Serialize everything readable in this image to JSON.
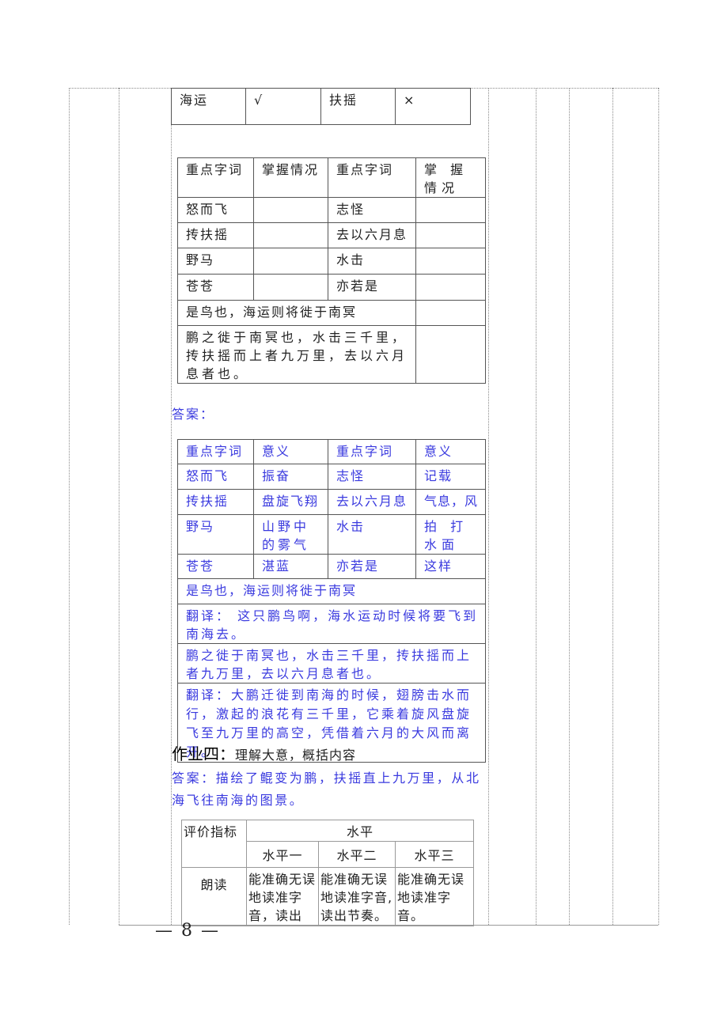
{
  "top_table": {
    "cells": [
      "海运",
      "√",
      "扶摇",
      "×"
    ]
  },
  "exercise_table": {
    "header": [
      "重点字词",
      "掌握情况",
      "重点字词",
      "掌 握 情况"
    ],
    "rows": [
      [
        "怒而飞",
        "",
        "志怪",
        ""
      ],
      [
        "抟扶摇",
        "",
        "去以六月息",
        ""
      ],
      [
        "野马",
        "",
        "水击",
        ""
      ],
      [
        "苍苍",
        "",
        "亦若是",
        ""
      ]
    ],
    "sentences": [
      "是鸟也，海运则将徙于南冥",
      "鹏之徙于南冥也，水击三千里，抟扶摇而上者九万里，去以六月息者也。"
    ]
  },
  "answer_label": "答案：",
  "answer_table": {
    "header": [
      "重点字词",
      "意义",
      "重点字词",
      "意义"
    ],
    "rows": [
      [
        "怒而飞",
        "振奋",
        "志怪",
        "记载"
      ],
      [
        "抟扶摇",
        "盘旋飞翔",
        "去以六月息",
        "气息，风"
      ],
      [
        "野马",
        "山野中的雾气",
        "水击",
        "拍 打 水面"
      ],
      [
        "苍苍",
        "湛蓝",
        "亦若是",
        "这样"
      ]
    ],
    "full_rows": [
      "是鸟也，海运则将徙于南冥",
      "翻译：  这只鹏鸟啊，海水运动时候将要飞到南海去。",
      "鹏之徙于南冥也，水击三千里，抟扶摇而上者九万里，去以六月息者也。",
      "翻译：大鹏迁徙到南海的时候，翅膀击水而行，激起的浪花有三千里，它乘着旋风盘旋飞至九万里的高空，凭借着六月的大风而离开。"
    ]
  },
  "homework4": {
    "title": "作业四：",
    "subtitle": "理解大意，概括内容",
    "answer": " 答案：描绘了鲲变为鹏，扶摇直上九万里，从北海飞往南海的图景。"
  },
  "eval_table": {
    "header_indicator": "评价指标",
    "header_level": "水平",
    "levels": [
      "水平一",
      "水平二",
      "水平三"
    ],
    "rows": [
      {
        "indicator": "朗读",
        "values": [
          "能准确无误地读准字音，读出",
          "能准确无误地读准字音,读出节奏。",
          "能准确无误地读准字音。"
        ]
      }
    ]
  },
  "page_number": "— 8 —"
}
